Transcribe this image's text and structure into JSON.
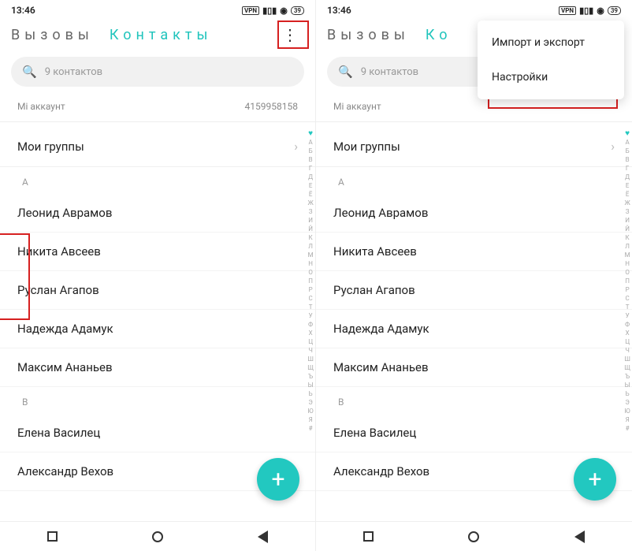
{
  "status": {
    "time": "13:46",
    "vpn": "VPN",
    "battery": "39"
  },
  "tabs": {
    "calls": "Вызовы",
    "contacts": "Контакты",
    "contacts_short": "Ко"
  },
  "search": {
    "placeholder": "9 контактов"
  },
  "account": {
    "label": "Mi аккаунт",
    "value": "4159958158"
  },
  "groups": {
    "label": "Мои группы"
  },
  "sections": {
    "A": {
      "letter": "A",
      "items": [
        "Леонид Аврамов",
        "Никита Авсеев",
        "Руслан Агапов",
        "Надежда Адамук",
        "Максим Ананьев"
      ]
    },
    "B": {
      "letter": "B",
      "items": [
        "Елена Василец",
        "Александр Вехов"
      ]
    }
  },
  "alpha": [
    "А",
    "Б",
    "В",
    "Г",
    "Д",
    "Е",
    "Ё",
    "Ж",
    "З",
    "И",
    "Й",
    "К",
    "Л",
    "М",
    "Н",
    "О",
    "П",
    "Р",
    "С",
    "Т",
    "У",
    "Ф",
    "Х",
    "Ц",
    "Ч",
    "Ш",
    "Щ",
    "Ъ",
    "Ы",
    "Ь",
    "Э",
    "Ю",
    "Я",
    "#"
  ],
  "menu": {
    "import_export": "Импорт и экспорт",
    "settings": "Настройки"
  }
}
